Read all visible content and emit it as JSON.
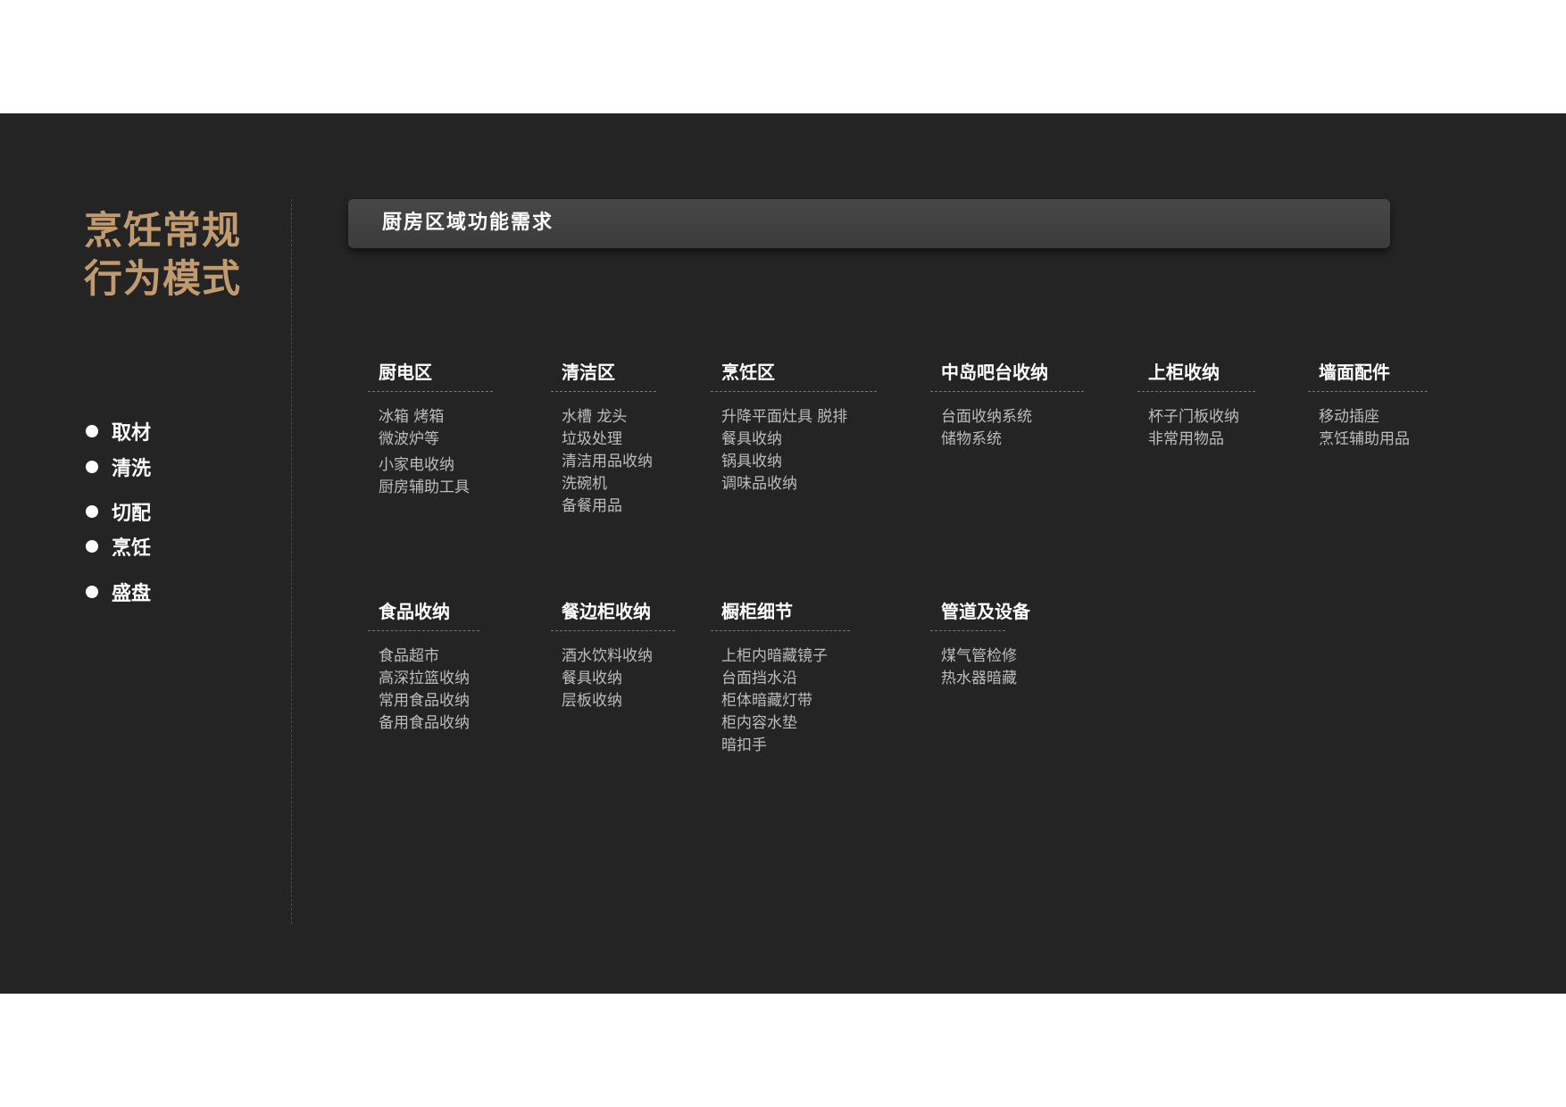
{
  "sidebar": {
    "title_line1": "烹饪常规",
    "title_line2": "行为模式",
    "bullets": [
      "取材",
      "清洗",
      "切配",
      "烹饪",
      "盛盘"
    ]
  },
  "header": {
    "title": "厨房区域功能需求"
  },
  "zones": [
    {
      "title": "厨电区",
      "items": [
        "冰箱 烤箱",
        "微波炉等",
        "小家电收纳",
        "厨房辅助工具"
      ]
    },
    {
      "title": "清洁区",
      "items": [
        "水槽 龙头",
        "垃圾处理",
        "清洁用品收纳",
        "洗碗机",
        "备餐用品"
      ]
    },
    {
      "title": "烹饪区",
      "items": [
        "升降平面灶具 脱排",
        "餐具收纳",
        "锅具收纳",
        "调味品收纳"
      ]
    },
    {
      "title": "中岛吧台收纳",
      "items": [
        "台面收纳系统",
        "储物系统"
      ]
    },
    {
      "title": "上柜收纳",
      "items": [
        "杯子门板收纳",
        "非常用物品"
      ]
    },
    {
      "title": "墙面配件",
      "items": [
        "移动插座",
        "烹饪辅助用品"
      ]
    },
    {
      "title": "食品收纳",
      "items": [
        "食品超市",
        "高深拉篮收纳",
        "常用食品收纳",
        "备用食品收纳"
      ]
    },
    {
      "title": "餐边柜收纳",
      "items": [
        "酒水饮料收纳",
        "餐具收纳",
        "层板收纳"
      ]
    },
    {
      "title": "橱柜细节",
      "items": [
        "上柜内暗藏镜子",
        "台面挡水沿",
        "柜体暗藏灯带",
        "柜内容水垫",
        "暗扣手"
      ]
    },
    {
      "title": "管道及设备",
      "items": [
        "煤气管检修",
        "热水器暗藏"
      ]
    }
  ]
}
